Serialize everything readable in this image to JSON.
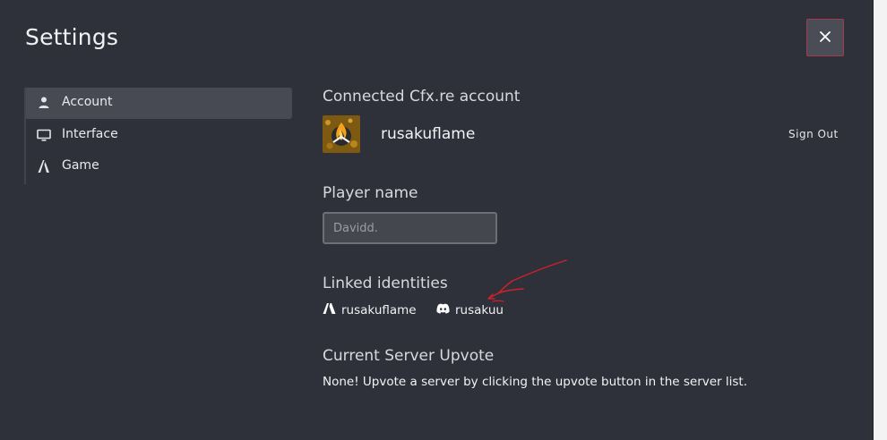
{
  "header": {
    "title": "Settings",
    "close_label": "✕"
  },
  "sidebar": {
    "items": [
      {
        "label": "Account",
        "icon": "user-icon",
        "active": true
      },
      {
        "label": "Interface",
        "icon": "monitor-icon",
        "active": false
      },
      {
        "label": "Game",
        "icon": "fivem-icon",
        "active": false
      }
    ]
  },
  "account": {
    "title": "Connected Cfx.re account",
    "avatar": "avatar-flame",
    "username": "rusakuflame",
    "signout_label": "Sign Out"
  },
  "player": {
    "title": "Player name",
    "placeholder": "Davidd."
  },
  "linked": {
    "title": "Linked identities",
    "identities": [
      {
        "icon": "fivem-icon",
        "name": "rusakuflame"
      },
      {
        "icon": "discord-icon",
        "name": "rusakuu"
      }
    ]
  },
  "upvote": {
    "title": "Current Server Upvote",
    "text": "None! Upvote a server by clicking the upvote button in the server list."
  },
  "colors": {
    "background": "#2f313a",
    "active_nav": "#474953",
    "close_border": "#a6394b",
    "annotation": "#d0202a"
  }
}
